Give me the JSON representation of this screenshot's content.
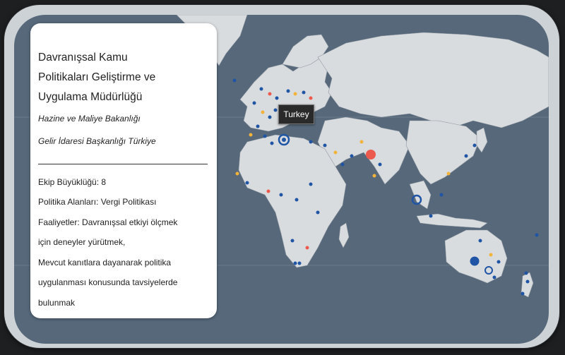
{
  "card": {
    "title_lines": [
      "Davranışsal Kamu",
      "Politikaları Geliştirme ve",
      "Uygulama Müdürlüğü"
    ],
    "org_line1": "Hazine ve Maliye Bakanlığı",
    "org_line2": "Gelir İdaresi Başkanlığı Türkiye",
    "team_size": "Ekip Büyüklüğü: 8",
    "policy_areas": "Politika Alanları: Vergi Politikası",
    "activities": [
      "Faaliyetler: Davranışsal etkiyi ölçmek",
      "için deneyler yürütmek,",
      "Mevcut kanıtlara dayanarak politika",
      "uygulanması konusunda tavsiyelerde",
      "bulunmak"
    ]
  },
  "tooltip": {
    "label": "Turkey"
  },
  "colors": {
    "ocean": "#56687a",
    "land": "#d9dcdf",
    "marker_blue": "#1f55a4",
    "marker_red": "#ec5a4d",
    "marker_yellow": "#f2b33a",
    "card_bg": "#ffffff",
    "tooltip_bg": "#2a2a2a"
  },
  "markers": {
    "note": "Institution markers; color indicates category"
  }
}
